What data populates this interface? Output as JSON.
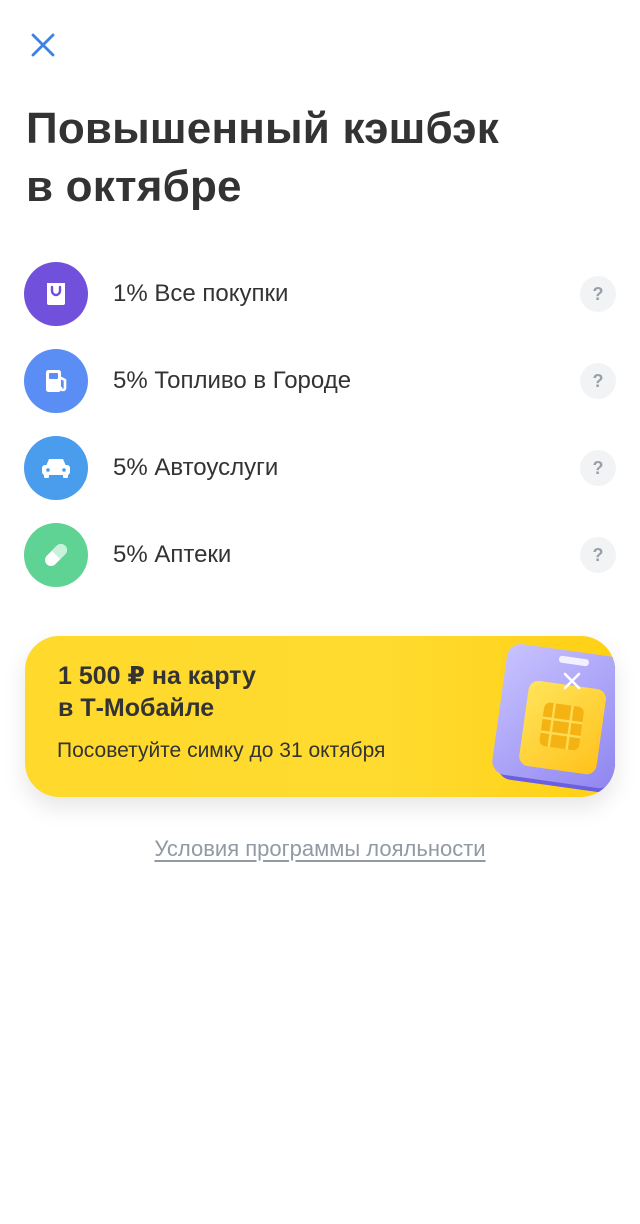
{
  "header": {
    "close_icon": "close-icon",
    "title_line1": "Повышенный кэшбэк",
    "title_line2": "в октябре"
  },
  "cashback": {
    "items": [
      {
        "label": "1% Все покупки",
        "icon": "shopping-bag-icon",
        "color": "#7151db",
        "help": "?"
      },
      {
        "label": "5% Топливо в Городе",
        "icon": "fuel-pump-icon",
        "color": "#5b8ef5",
        "help": "?"
      },
      {
        "label": "5% Автоуслуги",
        "icon": "car-icon",
        "color": "#4a9ded",
        "help": "?"
      },
      {
        "label": "5% Аптеки",
        "icon": "pill-icon",
        "color": "#5fd394",
        "help": "?"
      }
    ]
  },
  "promo": {
    "title_line1": "1 500 ₽ на карту",
    "title_line2": "в Т-Мобайле",
    "subtitle": "Посоветуйте симку до 31 октября",
    "close_icon": "close-icon",
    "art": "sim-card-icon",
    "background": "#ffdb30"
  },
  "footer": {
    "loyalty_link": "Условия программы лояльности"
  }
}
